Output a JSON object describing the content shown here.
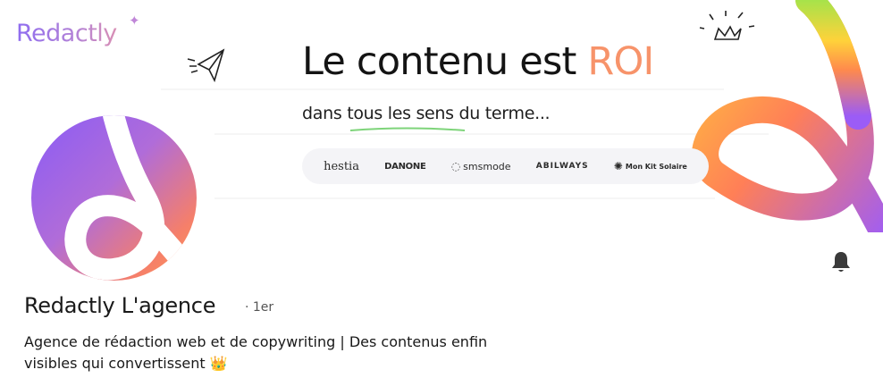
{
  "banner": {
    "brand": "Redactly",
    "headline_main": "Le contenu est ",
    "headline_accent": "ROI",
    "subline_before": "dans ",
    "subline_underlined": "tous les sens",
    "subline_after": " du terme...",
    "partners": [
      "hestia",
      "DANONE",
      "smsmode",
      "ABILWAYS",
      "Mon Kit Solaire"
    ],
    "colors": {
      "accent": "#f7936a",
      "purple": "#8a5cf6",
      "orange": "#ff9a55"
    }
  },
  "profile": {
    "name": "Redactly L'agence",
    "degree": "· 1er",
    "tagline_line1": "Agence de rédaction web et de copywriting | Des contenus enfin",
    "tagline_line2": "visibles qui convertissent",
    "tagline_emoji": "👑"
  },
  "actions": {
    "notification_icon": "bell-icon"
  }
}
